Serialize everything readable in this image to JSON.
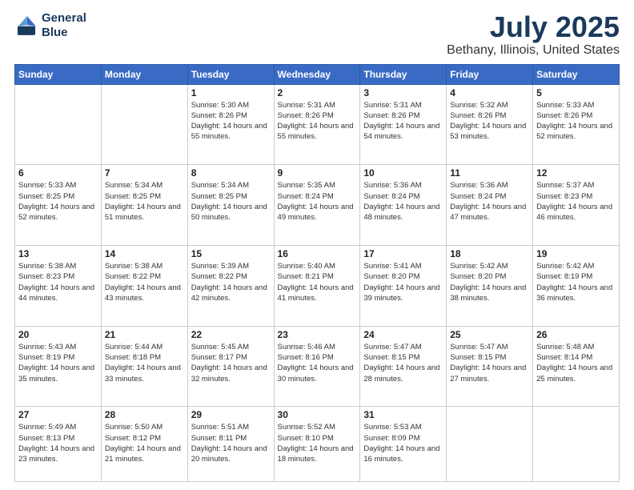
{
  "header": {
    "logo_line1": "General",
    "logo_line2": "Blue",
    "title": "July 2025",
    "subtitle": "Bethany, Illinois, United States"
  },
  "calendar": {
    "days_of_week": [
      "Sunday",
      "Monday",
      "Tuesday",
      "Wednesday",
      "Thursday",
      "Friday",
      "Saturday"
    ],
    "weeks": [
      [
        {
          "day": "",
          "info": ""
        },
        {
          "day": "",
          "info": ""
        },
        {
          "day": "1",
          "info": "Sunrise: 5:30 AM\nSunset: 8:26 PM\nDaylight: 14 hours\nand 55 minutes."
        },
        {
          "day": "2",
          "info": "Sunrise: 5:31 AM\nSunset: 8:26 PM\nDaylight: 14 hours\nand 55 minutes."
        },
        {
          "day": "3",
          "info": "Sunrise: 5:31 AM\nSunset: 8:26 PM\nDaylight: 14 hours\nand 54 minutes."
        },
        {
          "day": "4",
          "info": "Sunrise: 5:32 AM\nSunset: 8:26 PM\nDaylight: 14 hours\nand 53 minutes."
        },
        {
          "day": "5",
          "info": "Sunrise: 5:33 AM\nSunset: 8:26 PM\nDaylight: 14 hours\nand 52 minutes."
        }
      ],
      [
        {
          "day": "6",
          "info": "Sunrise: 5:33 AM\nSunset: 8:25 PM\nDaylight: 14 hours\nand 52 minutes."
        },
        {
          "day": "7",
          "info": "Sunrise: 5:34 AM\nSunset: 8:25 PM\nDaylight: 14 hours\nand 51 minutes."
        },
        {
          "day": "8",
          "info": "Sunrise: 5:34 AM\nSunset: 8:25 PM\nDaylight: 14 hours\nand 50 minutes."
        },
        {
          "day": "9",
          "info": "Sunrise: 5:35 AM\nSunset: 8:24 PM\nDaylight: 14 hours\nand 49 minutes."
        },
        {
          "day": "10",
          "info": "Sunrise: 5:36 AM\nSunset: 8:24 PM\nDaylight: 14 hours\nand 48 minutes."
        },
        {
          "day": "11",
          "info": "Sunrise: 5:36 AM\nSunset: 8:24 PM\nDaylight: 14 hours\nand 47 minutes."
        },
        {
          "day": "12",
          "info": "Sunrise: 5:37 AM\nSunset: 8:23 PM\nDaylight: 14 hours\nand 46 minutes."
        }
      ],
      [
        {
          "day": "13",
          "info": "Sunrise: 5:38 AM\nSunset: 8:23 PM\nDaylight: 14 hours\nand 44 minutes."
        },
        {
          "day": "14",
          "info": "Sunrise: 5:38 AM\nSunset: 8:22 PM\nDaylight: 14 hours\nand 43 minutes."
        },
        {
          "day": "15",
          "info": "Sunrise: 5:39 AM\nSunset: 8:22 PM\nDaylight: 14 hours\nand 42 minutes."
        },
        {
          "day": "16",
          "info": "Sunrise: 5:40 AM\nSunset: 8:21 PM\nDaylight: 14 hours\nand 41 minutes."
        },
        {
          "day": "17",
          "info": "Sunrise: 5:41 AM\nSunset: 8:20 PM\nDaylight: 14 hours\nand 39 minutes."
        },
        {
          "day": "18",
          "info": "Sunrise: 5:42 AM\nSunset: 8:20 PM\nDaylight: 14 hours\nand 38 minutes."
        },
        {
          "day": "19",
          "info": "Sunrise: 5:42 AM\nSunset: 8:19 PM\nDaylight: 14 hours\nand 36 minutes."
        }
      ],
      [
        {
          "day": "20",
          "info": "Sunrise: 5:43 AM\nSunset: 8:19 PM\nDaylight: 14 hours\nand 35 minutes."
        },
        {
          "day": "21",
          "info": "Sunrise: 5:44 AM\nSunset: 8:18 PM\nDaylight: 14 hours\nand 33 minutes."
        },
        {
          "day": "22",
          "info": "Sunrise: 5:45 AM\nSunset: 8:17 PM\nDaylight: 14 hours\nand 32 minutes."
        },
        {
          "day": "23",
          "info": "Sunrise: 5:46 AM\nSunset: 8:16 PM\nDaylight: 14 hours\nand 30 minutes."
        },
        {
          "day": "24",
          "info": "Sunrise: 5:47 AM\nSunset: 8:15 PM\nDaylight: 14 hours\nand 28 minutes."
        },
        {
          "day": "25",
          "info": "Sunrise: 5:47 AM\nSunset: 8:15 PM\nDaylight: 14 hours\nand 27 minutes."
        },
        {
          "day": "26",
          "info": "Sunrise: 5:48 AM\nSunset: 8:14 PM\nDaylight: 14 hours\nand 25 minutes."
        }
      ],
      [
        {
          "day": "27",
          "info": "Sunrise: 5:49 AM\nSunset: 8:13 PM\nDaylight: 14 hours\nand 23 minutes."
        },
        {
          "day": "28",
          "info": "Sunrise: 5:50 AM\nSunset: 8:12 PM\nDaylight: 14 hours\nand 21 minutes."
        },
        {
          "day": "29",
          "info": "Sunrise: 5:51 AM\nSunset: 8:11 PM\nDaylight: 14 hours\nand 20 minutes."
        },
        {
          "day": "30",
          "info": "Sunrise: 5:52 AM\nSunset: 8:10 PM\nDaylight: 14 hours\nand 18 minutes."
        },
        {
          "day": "31",
          "info": "Sunrise: 5:53 AM\nSunset: 8:09 PM\nDaylight: 14 hours\nand 16 minutes."
        },
        {
          "day": "",
          "info": ""
        },
        {
          "day": "",
          "info": ""
        }
      ]
    ]
  }
}
